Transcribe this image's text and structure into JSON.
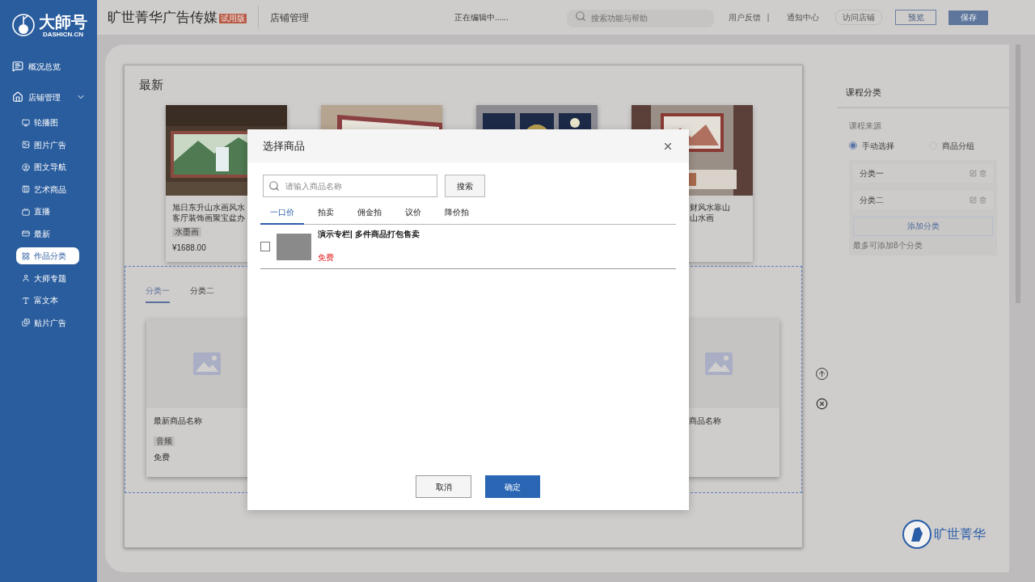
{
  "logo": {
    "name": "大師号",
    "domain": "DASHICN.CN"
  },
  "sidebar": {
    "items": [
      {
        "label": "概况总览",
        "selected": false
      },
      {
        "label": "店铺管理",
        "expanded": true,
        "selected": false,
        "children": [
          {
            "label": "轮播图",
            "selected": false
          },
          {
            "label": "图片广告",
            "selected": false
          },
          {
            "label": "图文导航",
            "selected": false
          },
          {
            "label": "艺术商品",
            "selected": false
          },
          {
            "label": "直播",
            "selected": false
          },
          {
            "label": "最新",
            "selected": false
          },
          {
            "label": "作品分类",
            "selected": true
          },
          {
            "label": "大师专题",
            "selected": false
          },
          {
            "label": "富文本",
            "selected": false
          },
          {
            "label": "贴片广告",
            "selected": false
          }
        ]
      }
    ]
  },
  "header": {
    "company": "旷世菁华广告传媒",
    "badge": "试用版",
    "section": "店铺管理",
    "status": "正在编辑中......",
    "search": {
      "placeholder": "搜索功能与帮助"
    },
    "links": [
      "用户反馈",
      "|",
      "通知中心"
    ],
    "visit": "访问店铺",
    "preview": "预览",
    "save": "保存"
  },
  "canvas": {
    "title": "最新",
    "products": [
      {
        "kind": "left",
        "lines": [
          "旭日东升山水画风水",
          "客厅装饰画聚宝盆办"
        ],
        "tag": "水墨画",
        "price": "¥1688.00"
      },
      {
        "kind": "hidden"
      },
      {
        "kind": "hidden"
      },
      {
        "kind": "right",
        "lines": [
          "财风水靠山",
          "山水画"
        ]
      }
    ],
    "tabs": [
      {
        "label": "分类一",
        "selected": true
      },
      {
        "label": "分类二",
        "selected": false
      }
    ],
    "items": [
      {
        "kind": "left",
        "name": "最新商品名称",
        "tag": "音频",
        "price": "免费"
      },
      {
        "kind": "right",
        "name": "商品名称"
      }
    ]
  },
  "panel": {
    "title": "课程分类",
    "source_label": "课程来源",
    "options": [
      {
        "label": "手动选择",
        "selected": true
      },
      {
        "label": "商品分组",
        "selected": false
      }
    ],
    "categories": [
      "分类一",
      "分类二"
    ],
    "add": "添加分类",
    "hint": "最多可添加8个分类"
  },
  "modal": {
    "title": "选择商品",
    "search": {
      "placeholder": "请输入商品名称"
    },
    "search_button": "搜索",
    "tabs": [
      {
        "label": "一口价",
        "selected": true
      },
      {
        "label": "拍卖",
        "selected": false
      },
      {
        "label": "佣金拍",
        "selected": false
      },
      {
        "label": "议价",
        "selected": false
      },
      {
        "label": "降价拍",
        "selected": false
      }
    ],
    "rows": [
      {
        "title": "演示专栏| 多件商品打包售卖",
        "price": "免费",
        "checked": false
      }
    ],
    "cancel": "取消",
    "confirm": "确定"
  },
  "brand": "旷世菁华"
}
